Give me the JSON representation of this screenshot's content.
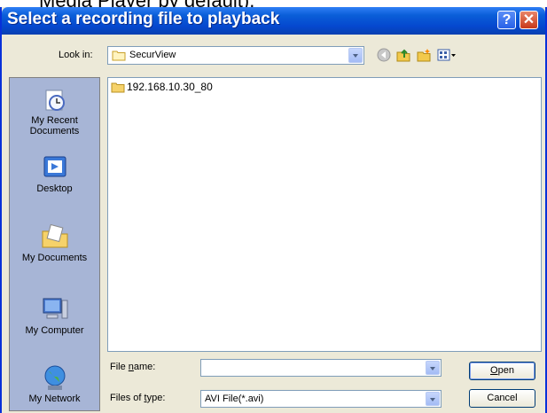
{
  "background_text": "Media Player by default).",
  "dialog": {
    "title": "Select a recording file to playback",
    "help_glyph": "?",
    "close_glyph": "✕"
  },
  "lookin": {
    "label": "Look in:",
    "label_accel": "i",
    "value": "SecurView"
  },
  "toolbar": {
    "icons": [
      "back-icon",
      "up-folder-icon",
      "new-folder-icon",
      "views-menu-icon"
    ]
  },
  "places": [
    {
      "label": "My Recent Documents",
      "icon": "recent-documents-icon"
    },
    {
      "label": "Desktop",
      "icon": "desktop-icon"
    },
    {
      "label": "My Documents",
      "icon": "my-documents-icon"
    },
    {
      "label": "My Computer",
      "icon": "my-computer-icon"
    },
    {
      "label": "My Network",
      "icon": "my-network-icon"
    }
  ],
  "files": [
    {
      "name": "192.168.10.30_80",
      "icon": "folder-icon"
    }
  ],
  "filename": {
    "label_pre": "File ",
    "label_accel": "n",
    "label_post": "ame:",
    "value": ""
  },
  "filetype": {
    "label_pre": "Files of ",
    "label_accel": "t",
    "label_post": "ype:",
    "value": "AVI File(*.avi)"
  },
  "buttons": {
    "open_accel": "O",
    "open_rest": "pen",
    "cancel": "Cancel"
  }
}
